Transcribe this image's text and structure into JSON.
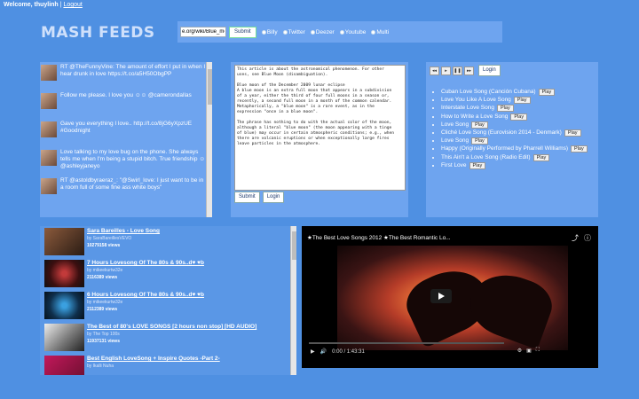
{
  "topbar": {
    "welcome": "Welcome, thuylinh",
    "separator": " | ",
    "logout": "Logout"
  },
  "logo": "MASH FEEDS",
  "search": {
    "value": "e.org/wiki/Blue_moon",
    "submit": "Submit",
    "options": [
      "Billy",
      "Twitter",
      "Deezer",
      "Youtube",
      "Multi"
    ]
  },
  "tweets": [
    {
      "text": "RT @TheFunnyVine: The amount of effort I put in when I hear drunk in love https://t.co/a5H50ObgPP"
    },
    {
      "text": "Follow me please. I love you ☺☺ @camerondallas"
    },
    {
      "text": "Gave you everything I love.. http://t.co/8jG6yXpzUE #Goodnight"
    },
    {
      "text": "Love talking to my love bug on the phone. She always tells me when I'm being a stupid bitch. True friendship ☺ @ashleyjaneyo"
    },
    {
      "text": "RT @astoldbyraeraz_: \"@Swirl_love: I just want to be in a room full of some fine ass white boys\""
    }
  ],
  "article": {
    "text": "This article is about the astronomical phenomenon. For other uses, see Blue Moon (disambiguation).\n\nBlue moon of the December 2009 lunar eclipse\nA blue moon is an extra full moon that appears in a subdivision of a year, either the third of four full moons in a season or, recently, a second full moon in a month of the common calendar. Metaphorically, a \"blue moon\" is a rare event, as in the expression \"once in a blue moon\".\n\nThe phrase has nothing to do with the actual color of the moon, although a literal \"blue moon\" (the moon appearing with a tinge of blue) may occur in certain atmospheric conditions; e.g., when there are volcanic eruptions or when exceptionally large fires leave particles in the atmosphere.",
    "submit": "Submit",
    "login": "Login"
  },
  "playlist": {
    "login": "Login",
    "play_label": "Play",
    "songs": [
      "Cuban Love Song (Canción Cubana)",
      "Love You Like A Love Song",
      "Interstate Love Song",
      "How to Write a Love Song",
      "Love Song",
      "Cliché Love Song (Eurovision 2014 - Denmark)",
      "Love Song",
      "Happy (Originally Performed by Pharrell Williams)",
      "This Ain't a Love Song (Radio Edit)",
      "First Love"
    ]
  },
  "videos": [
    {
      "title": "Sara Bareilles - Love Song",
      "by": "by SaraBareillesVEVO",
      "views": "10279158 views"
    },
    {
      "title": "7 Hours Lovesong Of The 80s & 90s..d♥ ♥b",
      "by": "by mikeekurtw32e",
      "views": "2116389 views"
    },
    {
      "title": "6 Hours Lovesong Of The 80s & 90s..d♥ ♥b",
      "by": "by mikeekurtw32e",
      "views": "2112389 views"
    },
    {
      "title": "The Best of 80's LOVE SONGS [2 hours non stop] [HD AUDIO]",
      "by": "by The Top 100s",
      "views": "11937131 views"
    },
    {
      "title": "Best English LoveSong + Inspire Quotes -Part 2-",
      "by": "by Ikalli Nuha",
      "views": ""
    }
  ],
  "player": {
    "title": "★The Best Love Songs 2012 ★The Best Romantic Lo...",
    "time": "0:00 / 1:43:31"
  }
}
